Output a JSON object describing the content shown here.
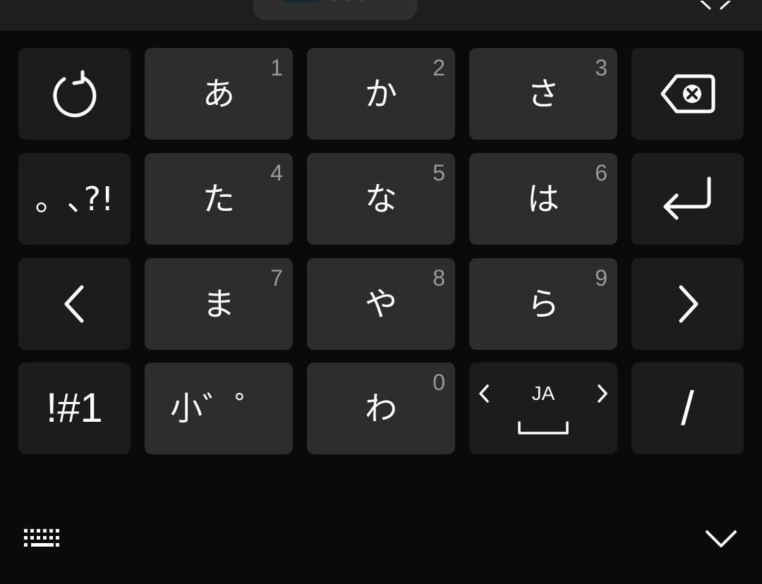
{
  "top_bar": {
    "pill_label": "Colar"
  },
  "keys": {
    "a": {
      "kana": "あ",
      "num": "1"
    },
    "ka": {
      "kana": "か",
      "num": "2"
    },
    "sa": {
      "kana": "さ",
      "num": "3"
    },
    "ta": {
      "kana": "た",
      "num": "4"
    },
    "na": {
      "kana": "な",
      "num": "5"
    },
    "ha": {
      "kana": "は",
      "num": "6"
    },
    "ma": {
      "kana": "ま",
      "num": "7"
    },
    "ya": {
      "kana": "や",
      "num": "8"
    },
    "ra": {
      "kana": "ら",
      "num": "9"
    },
    "wa": {
      "kana": "わ",
      "num": "0"
    },
    "small_kana": {
      "label": "小゛゜"
    },
    "punctuation": {
      "label": "。､?!"
    },
    "symbols": {
      "label": "!#1"
    },
    "language": {
      "label": "JA"
    },
    "slash": {
      "label": "/"
    }
  },
  "icons": {
    "undo": "undo-icon",
    "backspace": "backspace-icon",
    "enter": "enter-icon",
    "cursor_left": "chevron-left-icon",
    "cursor_right": "chevron-right-icon",
    "space": "space-bar-icon",
    "keyboard": "keyboard-icon",
    "collapse": "chevron-down-icon",
    "close": "close-icon"
  },
  "colors": {
    "background": "#0a0a0a",
    "key_dark": "#1c1c1c",
    "key_light": "#2d2d2d",
    "number_hint": "#9a9a9a"
  }
}
